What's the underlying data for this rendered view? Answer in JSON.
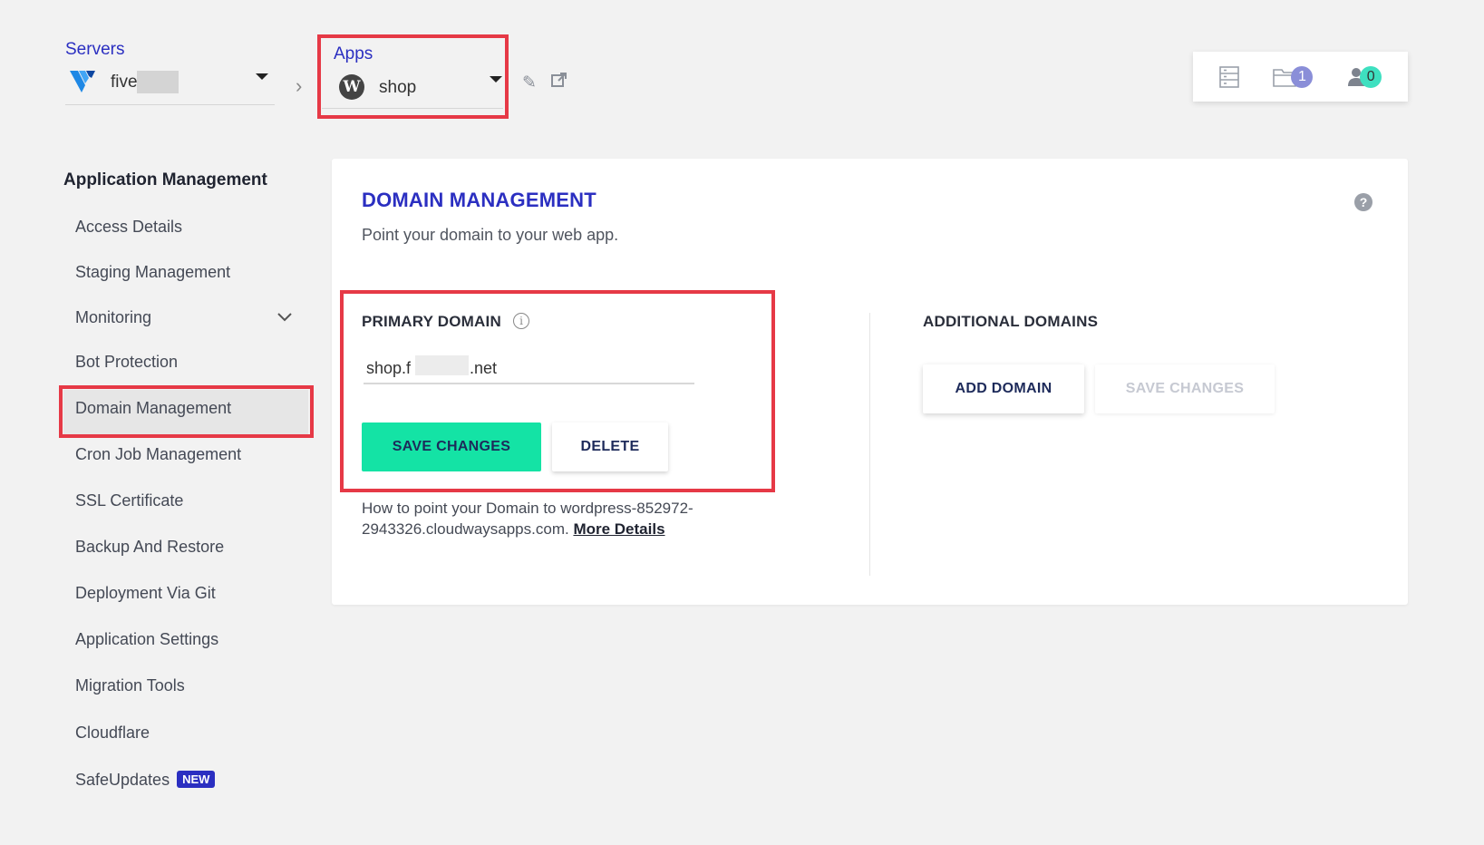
{
  "header": {
    "servers_label": "Servers",
    "server_name": "five",
    "apps_label": "Apps",
    "app_name": "shop",
    "folder_count": "1",
    "users_count": "0"
  },
  "sidebar": {
    "title": "Application Management",
    "items": [
      {
        "label": "Access Details"
      },
      {
        "label": "Staging Management"
      },
      {
        "label": "Monitoring"
      },
      {
        "label": "Bot Protection"
      },
      {
        "label": "Domain Management"
      },
      {
        "label": "Cron Job Management"
      },
      {
        "label": "SSL Certificate"
      },
      {
        "label": "Backup And Restore"
      },
      {
        "label": "Deployment Via Git"
      },
      {
        "label": "Application Settings"
      },
      {
        "label": "Migration Tools"
      },
      {
        "label": "Cloudflare"
      },
      {
        "label": "SafeUpdates"
      }
    ],
    "new_badge": "NEW"
  },
  "main": {
    "title": "DOMAIN MANAGEMENT",
    "subtitle": "Point your domain to your web app.",
    "primary": {
      "label": "PRIMARY DOMAIN",
      "value_prefix": "shop.f",
      "value_suffix": ".net",
      "save_label": "SAVE CHANGES",
      "delete_label": "DELETE"
    },
    "how_text": "How to point your Domain to wordpress-852972-2943326.cloudwaysapps.com.",
    "more_details": "More Details",
    "additional": {
      "label": "ADDITIONAL DOMAINS",
      "add_label": "ADD DOMAIN",
      "save_label": "SAVE CHANGES"
    }
  },
  "colors": {
    "accent": "#2b2fc1",
    "primary_button": "#14e3a5",
    "highlight": "#e63946"
  }
}
